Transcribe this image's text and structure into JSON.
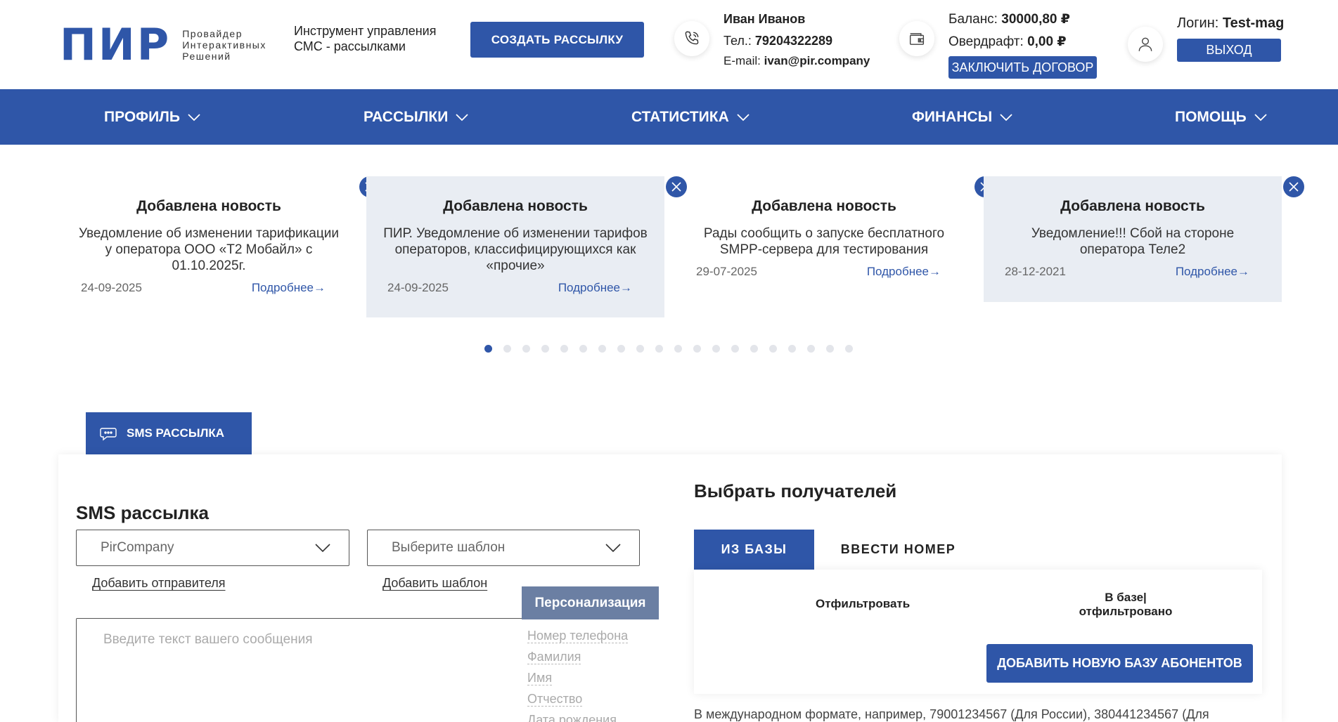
{
  "header": {
    "logo_mark": "ПИР",
    "logo_sub": [
      "Провайдер",
      "Интерактивных",
      "Решений"
    ],
    "tagline": "Инструмент управления СМС - рассылками",
    "create_label": "СОЗДАТЬ РАССЫЛКУ",
    "contact_name": "Иван Иванов",
    "phone_label": "Тел.: ",
    "phone": "79204322289",
    "email_label": "E-mail: ",
    "email": "ivan@pir.company",
    "balance_label": "Баланс: ",
    "balance": "30000,80 ₽",
    "overdraft_label": "Овердрафт: ",
    "overdraft": "0,00 ₽",
    "contract_label": "ЗАКЛЮЧИТЬ ДОГОВОР",
    "login_label": "Логин: ",
    "login": "Test-mag",
    "logout_label": "ВЫХОД"
  },
  "nav": [
    "ПРОФИЛЬ",
    "РАССЫЛКИ",
    "СТАТИСТИКА",
    "ФИНАНСЫ",
    "ПОМОЩЬ"
  ],
  "news": [
    {
      "title": "Добавлена новость",
      "text": "Уведомление об изменении тарификации у оператора ООО «Т2 Мобайл» с 01.10.2025г.",
      "date": "24-09-2025",
      "more": "Подробнее"
    },
    {
      "title": "Добавлена новость",
      "text": "ПИР. Уведомление об изменении тарифов операторов, классифицирующихся как «прочие»",
      "date": "24-09-2025",
      "more": "Подробнее"
    },
    {
      "title": "Добавлена новость",
      "text": "Рады сообщить о запуске бесплатного SMPP-сервера для тестирования",
      "date": "29-07-2025",
      "more": "Подробнее"
    },
    {
      "title": "Добавлена новость",
      "text": "Уведомление!!! Сбой на стороне оператора Теле2",
      "date": "28-12-2021",
      "more": "Подробнее"
    }
  ],
  "slider": {
    "count": 20,
    "active": 0
  },
  "sms": {
    "tab_label": "SMS РАССЫЛКА",
    "heading": "SMS рассылка",
    "sender_value": "PirCompany",
    "template_placeholder": "Выберите шаблон",
    "add_sender": "Добавить отправителя",
    "add_template": "Добавить шаблон",
    "message_placeholder": "Введите текст вашего сообщения",
    "personalization_title": "Персонализация",
    "personalization_items": [
      "Номер телефона",
      "Фамилия",
      "Имя",
      "Отчество",
      "Дата рождения"
    ]
  },
  "recipients": {
    "heading": "Выбрать получателей",
    "tab_base": "ИЗ БАЗЫ",
    "tab_manual": "ВВЕСТИ НОМЕР",
    "filter_label": "Отфильтровать",
    "base_label_1": "В базе|",
    "base_label_2": "отфильтровано",
    "add_base_label": "ДОБАВИТЬ НОВУЮ БАЗУ АБОНЕНТОВ",
    "hint": "В международном формате, например, 79001234567 (Для России), 380441234567 (Для"
  },
  "colors": {
    "brand": "#2f56a8",
    "news_bg": "#e9edf3"
  }
}
